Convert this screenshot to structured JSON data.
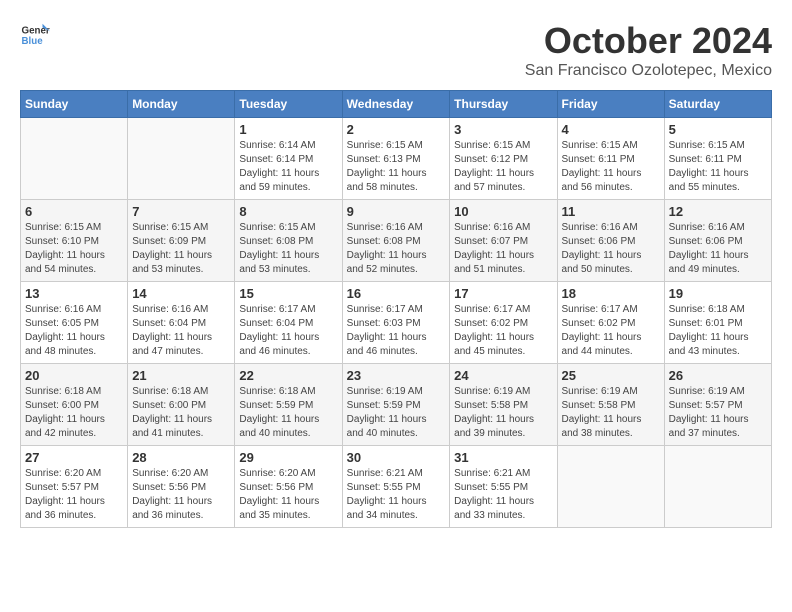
{
  "header": {
    "logo_general": "General",
    "logo_blue": "Blue",
    "main_title": "October 2024",
    "subtitle": "San Francisco Ozolotepec, Mexico"
  },
  "calendar": {
    "days_of_week": [
      "Sunday",
      "Monday",
      "Tuesday",
      "Wednesday",
      "Thursday",
      "Friday",
      "Saturday"
    ],
    "weeks": [
      [
        {
          "day": "",
          "info": ""
        },
        {
          "day": "",
          "info": ""
        },
        {
          "day": "1",
          "info": "Sunrise: 6:14 AM\nSunset: 6:14 PM\nDaylight: 11 hours and 59 minutes."
        },
        {
          "day": "2",
          "info": "Sunrise: 6:15 AM\nSunset: 6:13 PM\nDaylight: 11 hours and 58 minutes."
        },
        {
          "day": "3",
          "info": "Sunrise: 6:15 AM\nSunset: 6:12 PM\nDaylight: 11 hours and 57 minutes."
        },
        {
          "day": "4",
          "info": "Sunrise: 6:15 AM\nSunset: 6:11 PM\nDaylight: 11 hours and 56 minutes."
        },
        {
          "day": "5",
          "info": "Sunrise: 6:15 AM\nSunset: 6:11 PM\nDaylight: 11 hours and 55 minutes."
        }
      ],
      [
        {
          "day": "6",
          "info": "Sunrise: 6:15 AM\nSunset: 6:10 PM\nDaylight: 11 hours and 54 minutes."
        },
        {
          "day": "7",
          "info": "Sunrise: 6:15 AM\nSunset: 6:09 PM\nDaylight: 11 hours and 53 minutes."
        },
        {
          "day": "8",
          "info": "Sunrise: 6:15 AM\nSunset: 6:08 PM\nDaylight: 11 hours and 53 minutes."
        },
        {
          "day": "9",
          "info": "Sunrise: 6:16 AM\nSunset: 6:08 PM\nDaylight: 11 hours and 52 minutes."
        },
        {
          "day": "10",
          "info": "Sunrise: 6:16 AM\nSunset: 6:07 PM\nDaylight: 11 hours and 51 minutes."
        },
        {
          "day": "11",
          "info": "Sunrise: 6:16 AM\nSunset: 6:06 PM\nDaylight: 11 hours and 50 minutes."
        },
        {
          "day": "12",
          "info": "Sunrise: 6:16 AM\nSunset: 6:06 PM\nDaylight: 11 hours and 49 minutes."
        }
      ],
      [
        {
          "day": "13",
          "info": "Sunrise: 6:16 AM\nSunset: 6:05 PM\nDaylight: 11 hours and 48 minutes."
        },
        {
          "day": "14",
          "info": "Sunrise: 6:16 AM\nSunset: 6:04 PM\nDaylight: 11 hours and 47 minutes."
        },
        {
          "day": "15",
          "info": "Sunrise: 6:17 AM\nSunset: 6:04 PM\nDaylight: 11 hours and 46 minutes."
        },
        {
          "day": "16",
          "info": "Sunrise: 6:17 AM\nSunset: 6:03 PM\nDaylight: 11 hours and 46 minutes."
        },
        {
          "day": "17",
          "info": "Sunrise: 6:17 AM\nSunset: 6:02 PM\nDaylight: 11 hours and 45 minutes."
        },
        {
          "day": "18",
          "info": "Sunrise: 6:17 AM\nSunset: 6:02 PM\nDaylight: 11 hours and 44 minutes."
        },
        {
          "day": "19",
          "info": "Sunrise: 6:18 AM\nSunset: 6:01 PM\nDaylight: 11 hours and 43 minutes."
        }
      ],
      [
        {
          "day": "20",
          "info": "Sunrise: 6:18 AM\nSunset: 6:00 PM\nDaylight: 11 hours and 42 minutes."
        },
        {
          "day": "21",
          "info": "Sunrise: 6:18 AM\nSunset: 6:00 PM\nDaylight: 11 hours and 41 minutes."
        },
        {
          "day": "22",
          "info": "Sunrise: 6:18 AM\nSunset: 5:59 PM\nDaylight: 11 hours and 40 minutes."
        },
        {
          "day": "23",
          "info": "Sunrise: 6:19 AM\nSunset: 5:59 PM\nDaylight: 11 hours and 40 minutes."
        },
        {
          "day": "24",
          "info": "Sunrise: 6:19 AM\nSunset: 5:58 PM\nDaylight: 11 hours and 39 minutes."
        },
        {
          "day": "25",
          "info": "Sunrise: 6:19 AM\nSunset: 5:58 PM\nDaylight: 11 hours and 38 minutes."
        },
        {
          "day": "26",
          "info": "Sunrise: 6:19 AM\nSunset: 5:57 PM\nDaylight: 11 hours and 37 minutes."
        }
      ],
      [
        {
          "day": "27",
          "info": "Sunrise: 6:20 AM\nSunset: 5:57 PM\nDaylight: 11 hours and 36 minutes."
        },
        {
          "day": "28",
          "info": "Sunrise: 6:20 AM\nSunset: 5:56 PM\nDaylight: 11 hours and 36 minutes."
        },
        {
          "day": "29",
          "info": "Sunrise: 6:20 AM\nSunset: 5:56 PM\nDaylight: 11 hours and 35 minutes."
        },
        {
          "day": "30",
          "info": "Sunrise: 6:21 AM\nSunset: 5:55 PM\nDaylight: 11 hours and 34 minutes."
        },
        {
          "day": "31",
          "info": "Sunrise: 6:21 AM\nSunset: 5:55 PM\nDaylight: 11 hours and 33 minutes."
        },
        {
          "day": "",
          "info": ""
        },
        {
          "day": "",
          "info": ""
        }
      ]
    ]
  }
}
